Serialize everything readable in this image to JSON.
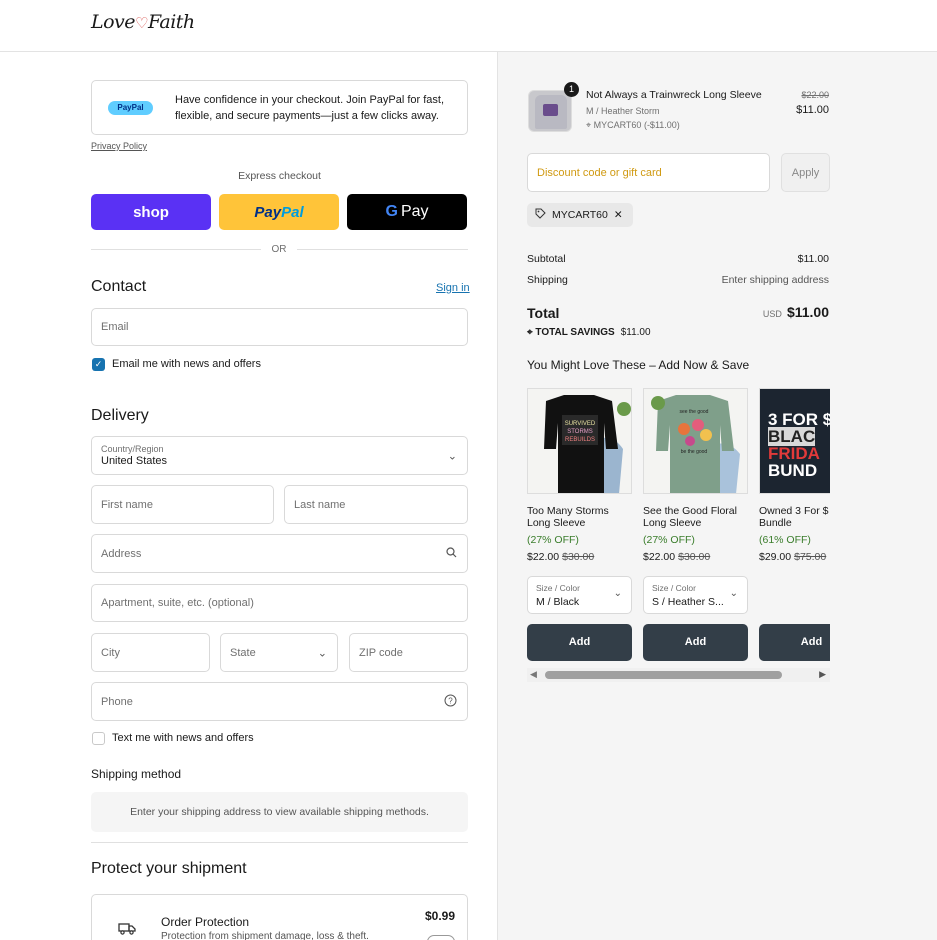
{
  "brand": {
    "logo_left": "Love",
    "logo_heart": "♡",
    "logo_right": "Faith"
  },
  "paypal_banner": {
    "badge": "PayPal",
    "text": "Have confidence in your checkout. Join PayPal for fast, flexible, and secure payments—just a few clicks away.",
    "privacy_link": "Privacy Policy"
  },
  "express": {
    "label": "Express checkout",
    "shop": "shop",
    "paypal_pay": "Pay",
    "paypal_pal": "Pal",
    "gpay_g": "G",
    "gpay_label": "Pay",
    "or": "OR"
  },
  "contact": {
    "heading": "Contact",
    "signin": "Sign in",
    "email_placeholder": "Email",
    "email_opt_in": "Email me with news and offers",
    "email_opt_in_checked": true
  },
  "delivery": {
    "heading": "Delivery",
    "country_label": "Country/Region",
    "country_value": "United States",
    "first_name": "First name",
    "last_name": "Last name",
    "address": "Address",
    "apartment": "Apartment, suite, etc. (optional)",
    "city": "City",
    "state": "State",
    "zip": "ZIP code",
    "phone": "Phone",
    "sms_opt_in": "Text me with news and offers",
    "sms_opt_in_checked": false
  },
  "shipping": {
    "heading": "Shipping method",
    "message": "Enter your shipping address to view available shipping methods."
  },
  "protection": {
    "heading": "Protect your shipment",
    "title": "Order Protection",
    "subtitle": "Protection from shipment damage, loss & theft.",
    "price": "$0.99"
  },
  "cart": {
    "item": {
      "quantity": "1",
      "name": "Not Always a Trainwreck Long Sleeve",
      "variant": "M / Heather Storm",
      "discount": "MYCART60 (-$11.00)",
      "original_price": "$22.00",
      "price": "$11.00"
    },
    "discount_placeholder": "Discount code or gift card",
    "apply": "Apply",
    "applied_code": "MYCART60",
    "subtotal_label": "Subtotal",
    "subtotal": "$11.00",
    "shipping_label": "Shipping",
    "shipping_value": "Enter shipping address",
    "total_label": "Total",
    "currency": "USD",
    "total": "$11.00",
    "savings_label": "TOTAL SAVINGS",
    "savings": "$11.00"
  },
  "upsell": {
    "heading": "You Might Love These – Add Now & Save",
    "products": [
      {
        "name_1": "Too Many Storms",
        "name_2": "Long Sleeve",
        "off": "(27% OFF)",
        "price": "$22.00",
        "was": "$30.00",
        "select_label": "Size / Color",
        "select_value": "M / Black",
        "add": "Add"
      },
      {
        "name_1": "See the Good Floral",
        "name_2": "Long Sleeve",
        "off": "(27% OFF)",
        "price": "$22.00",
        "was": "$30.00",
        "select_label": "Size / Color",
        "select_value": "S / Heather S...",
        "add": "Add"
      },
      {
        "name_1": "Owned 3 For $",
        "name_2": "Bundle",
        "off": "(61% OFF)",
        "price": "$29.00",
        "was": "$75.00",
        "add": "Add",
        "banner_1": "3 FOR $",
        "banner_2": "BLAC",
        "banner_3": "FRIDA",
        "banner_4": "BUND"
      }
    ]
  },
  "colors": {
    "accent": "#1773b0",
    "shop_pay": "#5a31f4",
    "paypal_yellow": "#ffc439",
    "add_button": "#333e48",
    "savings_green": "#3a7d2b"
  }
}
